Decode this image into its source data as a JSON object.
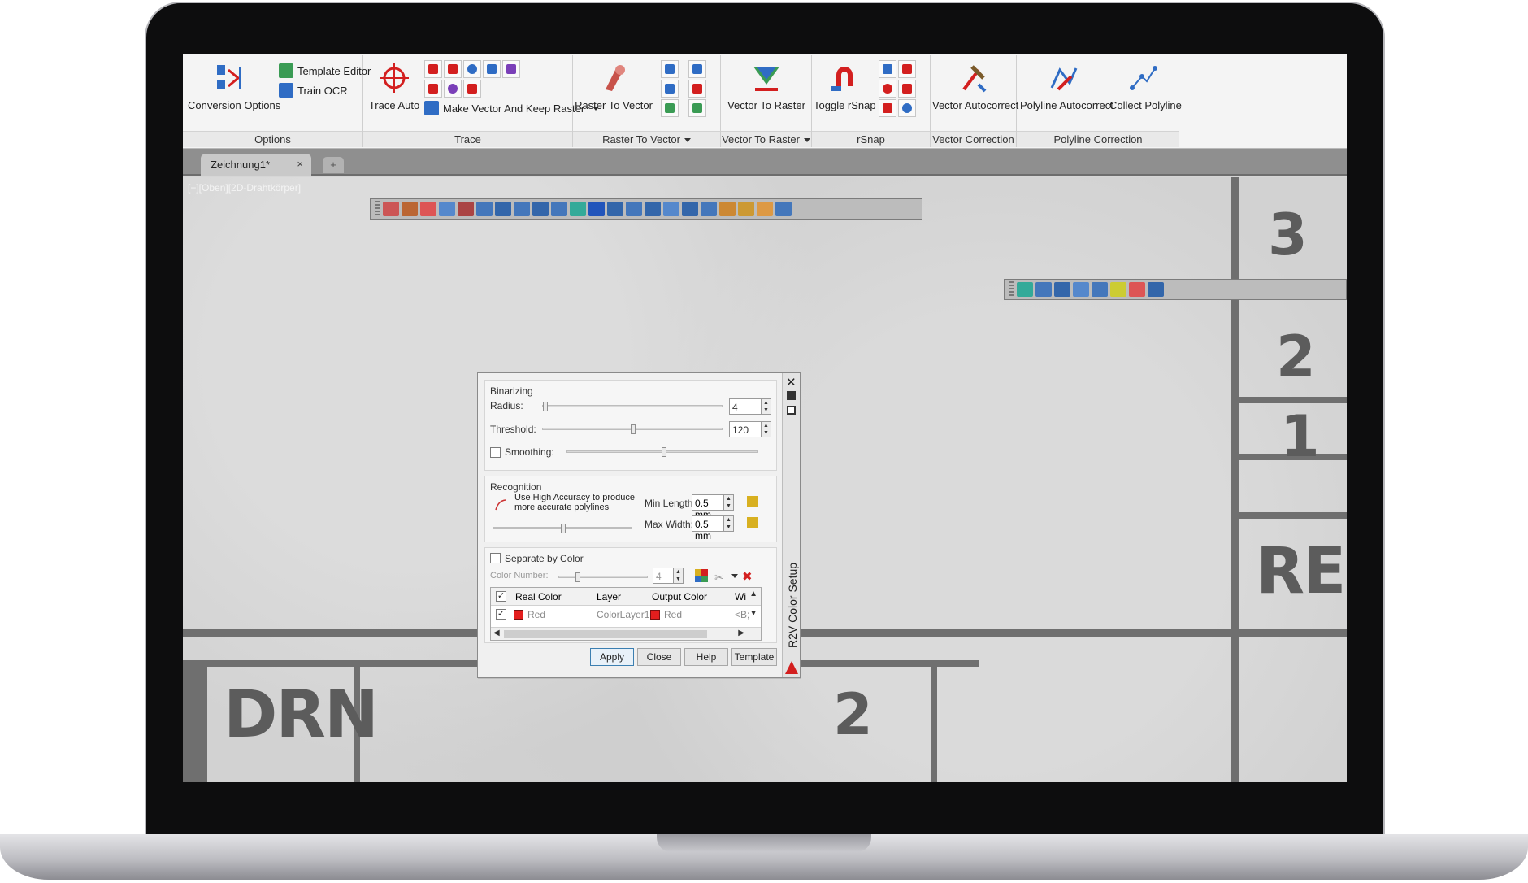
{
  "ribbon": {
    "options": {
      "label": "Options",
      "conversion_options": "Conversion Options",
      "template_editor": "Template Editor",
      "train_ocr": "Train OCR"
    },
    "trace": {
      "label": "Trace",
      "trace_auto": "Trace Auto",
      "make_vector": "Make Vector And Keep Raster"
    },
    "raster_to_vector": {
      "label": "Raster To Vector",
      "button": "Raster To Vector"
    },
    "vector_to_raster": {
      "label": "Vector To Raster",
      "button": "Vector To Raster"
    },
    "rsnap": {
      "label": "rSnap",
      "toggle": "Toggle rSnap"
    },
    "vector_correction": {
      "label": "Vector Correction",
      "button": "Vector Autocorrect"
    },
    "polyline_correction": {
      "label": "Polyline Correction",
      "autocorrect": "Polyline Autocorrect",
      "collect": "Collect Polyline"
    }
  },
  "tabs": {
    "doc": "Zeichnung1*",
    "close": "×",
    "new": "+"
  },
  "viewport": {
    "label": "[−][Oben][2D-Drahtkörper]"
  },
  "drawing_text": {
    "drn": "DRN",
    "re": "RE",
    "digit_3": "3",
    "digit_2a": "2",
    "digit_1": "1",
    "digit_2b": "2"
  },
  "dialog": {
    "title": "R2V Color Setup",
    "binarizing": {
      "title": "Binarizing",
      "radius_label": "Radius:",
      "radius_value": "4",
      "threshold_label": "Threshold:",
      "threshold_value": "120",
      "smoothing_label": "Smoothing:"
    },
    "recognition": {
      "title": "Recognition",
      "high_accuracy": "Use High Accuracy to produce more accurate polylines",
      "min_length_label": "Min Length:",
      "min_length_value": "0.5 mm",
      "max_width_label": "Max Width:",
      "max_width_value": "0.5 mm"
    },
    "color": {
      "separate_label": "Separate by Color",
      "color_number_label": "Color Number:",
      "color_number_value": "4",
      "columns": [
        "Real Color",
        "Layer",
        "Output Color",
        "Wi"
      ],
      "row": {
        "real_color": "Red",
        "layer": "ColorLayer1",
        "output_color": "Red",
        "width": "<B;"
      }
    },
    "buttons": {
      "apply": "Apply",
      "close": "Close",
      "help": "Help",
      "template": "Template"
    }
  },
  "colors": {
    "accent_red": "#d31f1f",
    "accent_blue": "#1f6fd6",
    "swatch_red": "#e41e1e"
  }
}
